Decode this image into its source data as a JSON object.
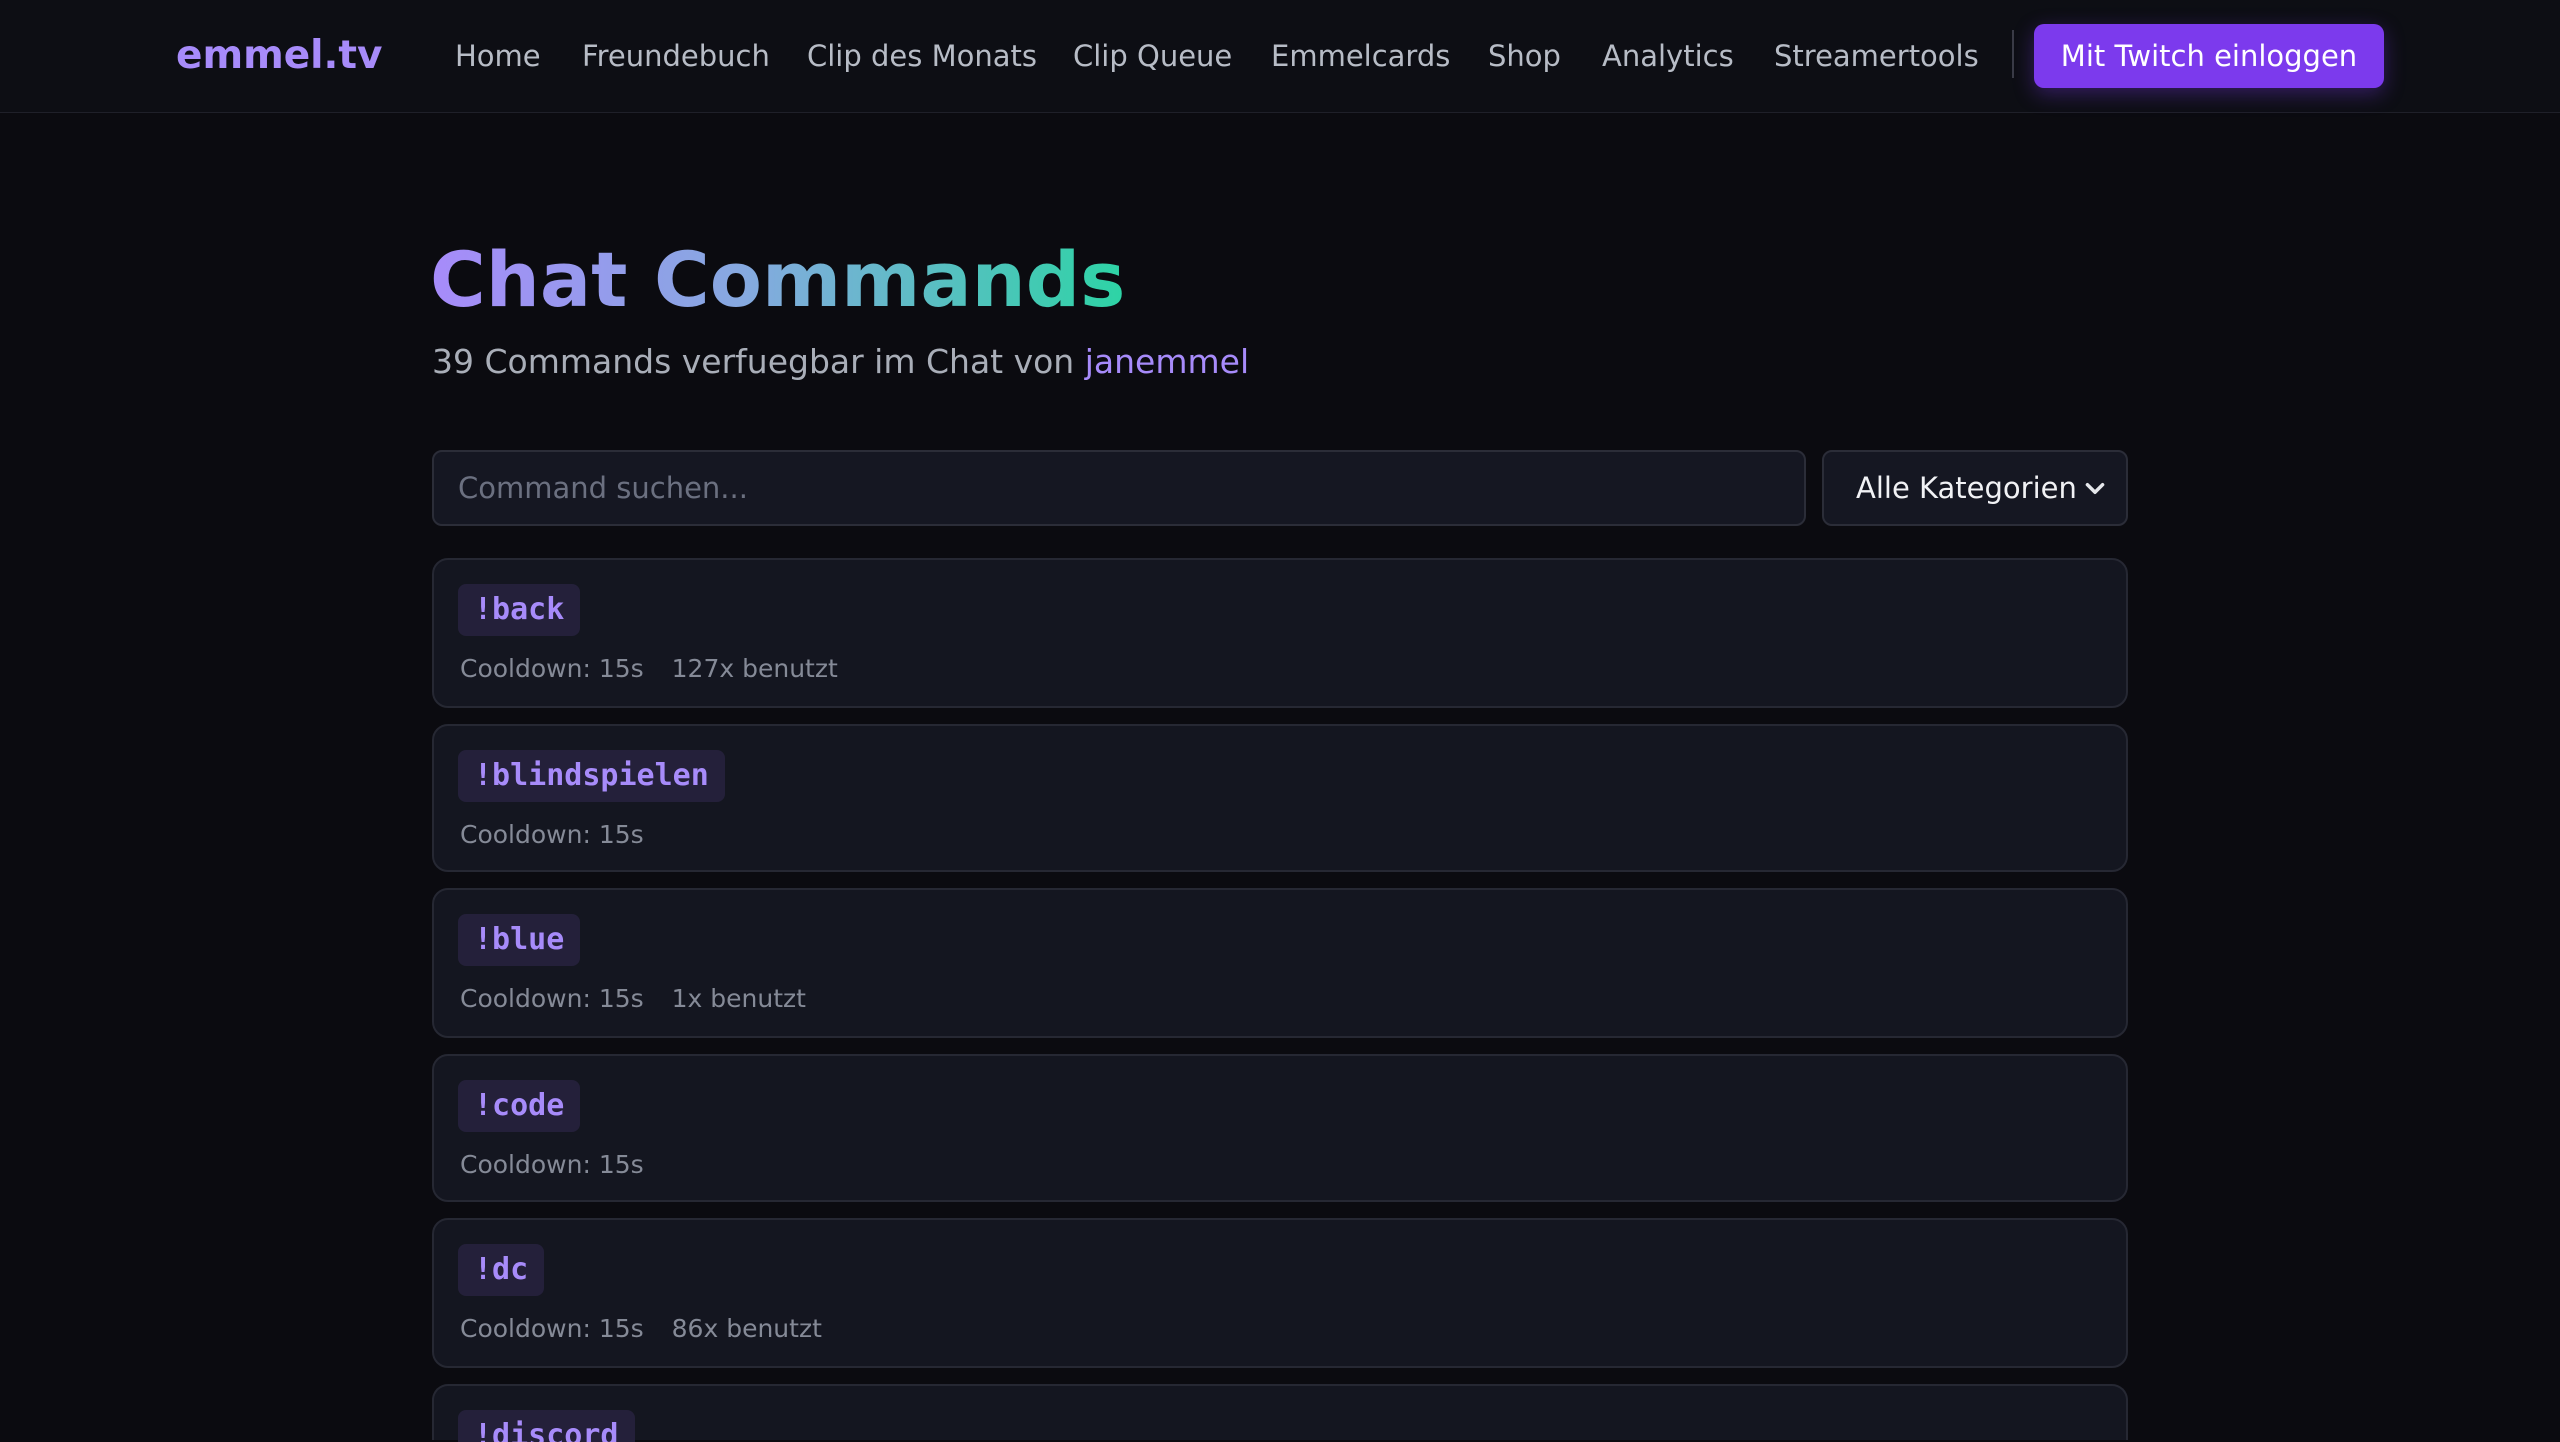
{
  "header": {
    "logo": "emmel.tv",
    "nav": [
      {
        "label": "Home"
      },
      {
        "label": "Freundebuch"
      },
      {
        "label": "Clip des Monats"
      },
      {
        "label": "Clip Queue"
      },
      {
        "label": "Emmelcards"
      },
      {
        "label": "Shop"
      },
      {
        "label": "Analytics"
      },
      {
        "label": "Streamertools"
      }
    ],
    "login_label": "Mit Twitch einloggen"
  },
  "main": {
    "title": "Chat Commands",
    "subtitle_prefix": "39 Commands verfuegbar im Chat von",
    "subtitle_user": "janemmel",
    "search_placeholder": "Command suchen...",
    "category_selected": "Alle Kategorien",
    "commands": [
      {
        "name": "!back",
        "cooldown": "Cooldown: 15s",
        "uses": "127x benutzt"
      },
      {
        "name": "!blindspielen",
        "cooldown": "Cooldown: 15s",
        "uses": ""
      },
      {
        "name": "!blue",
        "cooldown": "Cooldown: 15s",
        "uses": "1x benutzt"
      },
      {
        "name": "!code",
        "cooldown": "Cooldown: 15s",
        "uses": ""
      },
      {
        "name": "!dc",
        "cooldown": "Cooldown: 15s",
        "uses": "86x benutzt"
      },
      {
        "name": "!discord",
        "cooldown": "",
        "uses": ""
      }
    ]
  },
  "colors": {
    "background": "#0b0b10",
    "accent": "#a78bfa",
    "button": "#7c3aed",
    "card": "#141620",
    "title_gradient_end": "#2dd4a5"
  },
  "icons": {
    "category_dropdown": "chevron-down-icon"
  }
}
